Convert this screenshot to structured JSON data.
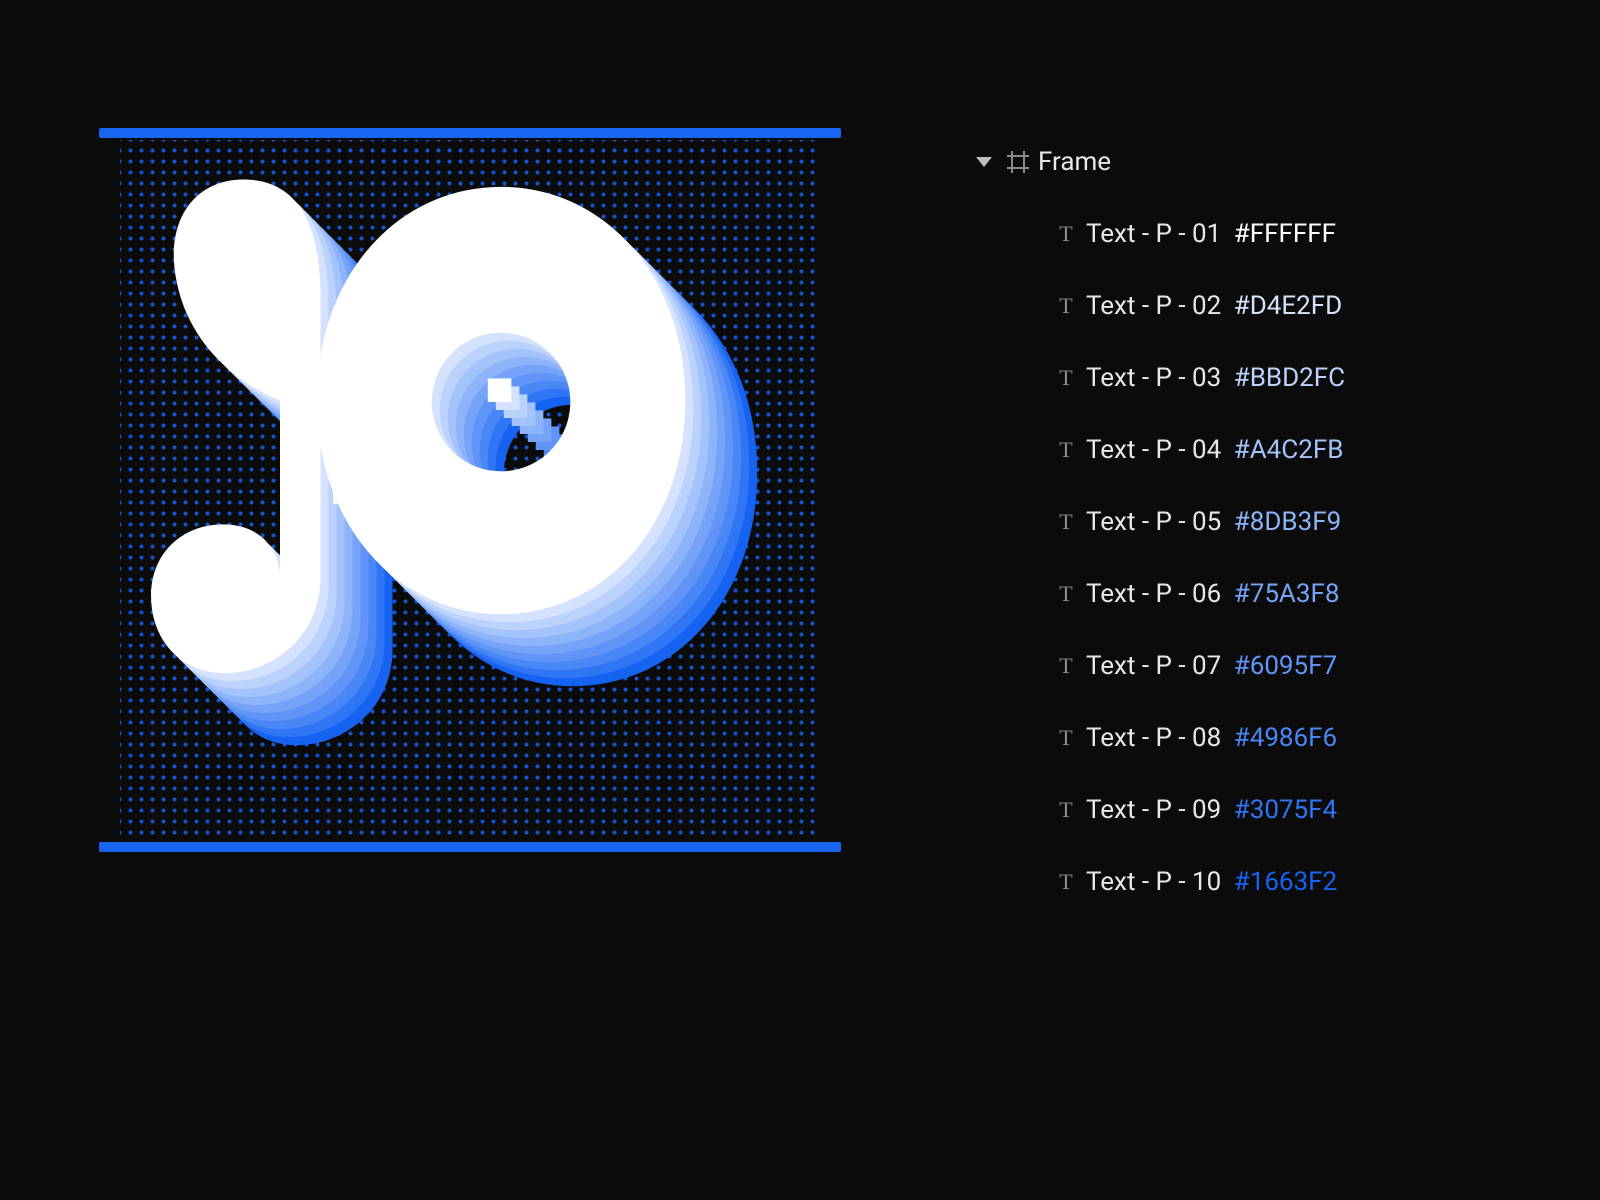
{
  "selection_color": "#1865F0",
  "frame": {
    "name": "Frame",
    "expanded": true
  },
  "layers": [
    {
      "index": "01",
      "hex": "#FFFFFF"
    },
    {
      "index": "02",
      "hex": "#D4E2FD"
    },
    {
      "index": "03",
      "hex": "#BBD2FC"
    },
    {
      "index": "04",
      "hex": "#A4C2FB"
    },
    {
      "index": "05",
      "hex": "#8DB3F9"
    },
    {
      "index": "06",
      "hex": "#75A3F8"
    },
    {
      "index": "07",
      "hex": "#6095F7"
    },
    {
      "index": "08",
      "hex": "#4986F6"
    },
    {
      "index": "09",
      "hex": "#3075F4"
    },
    {
      "index": "10",
      "hex": "#1663F2"
    }
  ],
  "layer_label_prefix": "Text - P - "
}
